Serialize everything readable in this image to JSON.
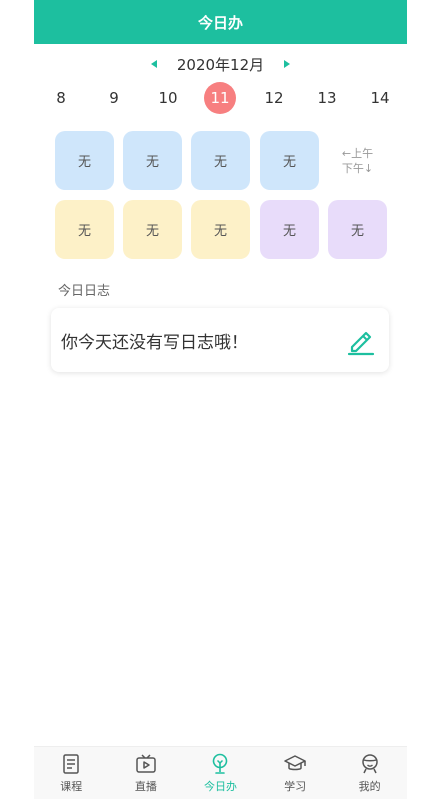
{
  "header": {
    "title": "今日办"
  },
  "calendar": {
    "month": "2020年12月",
    "days": [
      "8",
      "9",
      "10",
      "11",
      "12",
      "13",
      "14"
    ],
    "selected_day": "11"
  },
  "schedule": {
    "row1": [
      "无",
      "无",
      "无",
      "无"
    ],
    "legend_top": "←上午",
    "legend_bottom": "下午↓",
    "row2": [
      "无",
      "无",
      "无",
      "无",
      "无"
    ]
  },
  "log": {
    "title": "今日日志",
    "empty_text": "你今天还没有写日志哦！"
  },
  "tabbar": {
    "items": [
      {
        "label": "课程",
        "icon": "course-icon"
      },
      {
        "label": "直播",
        "icon": "live-icon"
      },
      {
        "label": "今日办",
        "icon": "today-icon"
      },
      {
        "label": "学习",
        "icon": "study-icon"
      },
      {
        "label": "我的",
        "icon": "profile-icon"
      }
    ],
    "active": "今日办"
  },
  "colors": {
    "accent": "#1dbf9f",
    "selected_day": "#f77f80",
    "blue_cell": "#cfe6fb",
    "yellow_cell": "#fdf1c8",
    "purple_cell": "#e8dcfa"
  }
}
